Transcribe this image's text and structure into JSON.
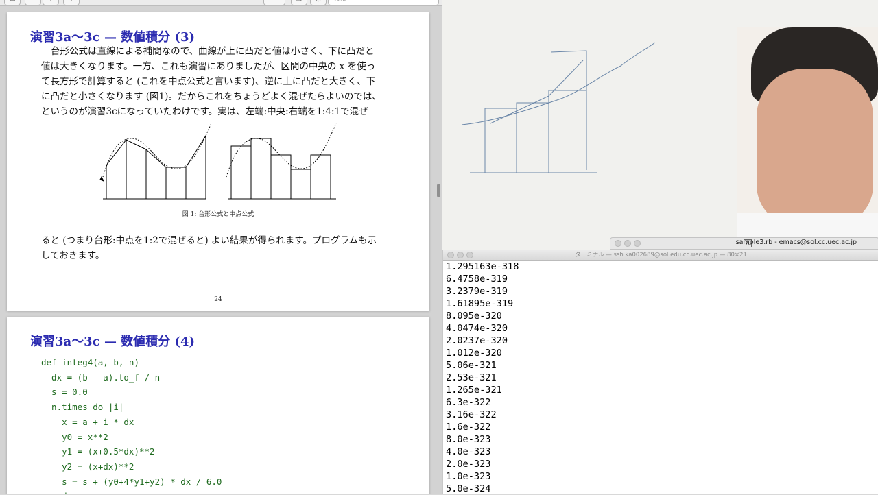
{
  "viewer": {
    "search_placeholder": "検索",
    "toolbar_icons": [
      "sidebar-icon",
      "zoom-out-icon",
      "zoom-in-icon",
      "share-icon",
      "pen-icon",
      "copy-icon",
      "annotate-icon",
      "search-icon"
    ]
  },
  "page1": {
    "title": "演習3a〜3c — 数値積分 (3)",
    "paragraph1": [
      "台形公式は直線による補間なので、曲線が上に凸だと値は小さく、下に凸だと",
      "値は大きくなります。一方、これも演習にありましたが、区間の中央の x を使っ",
      "て長方形で計算すると (これを中点公式と言います)、逆に上に凸だと大きく、下",
      "に凸だと小さくなります (図1)。だからこれをちょうどよく混ぜたらよいのでは、",
      "というのが演習3cになっていたわけです。実は、左端:中央:右端を1:4:1で混ぜ"
    ],
    "figure_caption": "図 1: 台形公式と中点公式",
    "paragraph2": [
      "ると (つまり台形:中点を1:2で混ぜると) よい結果が得られます。プログラムも示",
      "しておきます。"
    ],
    "page_number": "24"
  },
  "page2": {
    "title": "演習3a〜3c — 数値積分 (4)",
    "code_lines": [
      "def integ4(a, b, n)",
      "  dx = (b - a).to_f / n",
      "  s = 0.0",
      "  n.times do |i|",
      "    x = a + i * dx",
      "    y0 = x**2",
      "    y1 = (x+0.5*dx)**2",
      "    y2 = (x+dx)**2",
      "    s = s + (y0+4*y1+y2) * dx / 6.0",
      "  end"
    ]
  },
  "emacs": {
    "title": "sample3.rb - emacs@sol.cc.uec.ac.jp"
  },
  "terminal": {
    "title": "ターミナル — ssh ka002689@sol.edu.cc.uec.ac.jp — 80×21",
    "lines": [
      "1.295163e-318",
      "6.4758e-319",
      "3.2379e-319",
      "1.61895e-319",
      "8.095e-320",
      "4.0474e-320",
      "2.0237e-320",
      "1.012e-320",
      "5.06e-321",
      "2.53e-321",
      "1.265e-321",
      "6.3e-322",
      "3.16e-322",
      "1.6e-322",
      "8.0e-323",
      "4.0e-323",
      "2.0e-323",
      "1.0e-323",
      "5.0e-324"
    ]
  }
}
